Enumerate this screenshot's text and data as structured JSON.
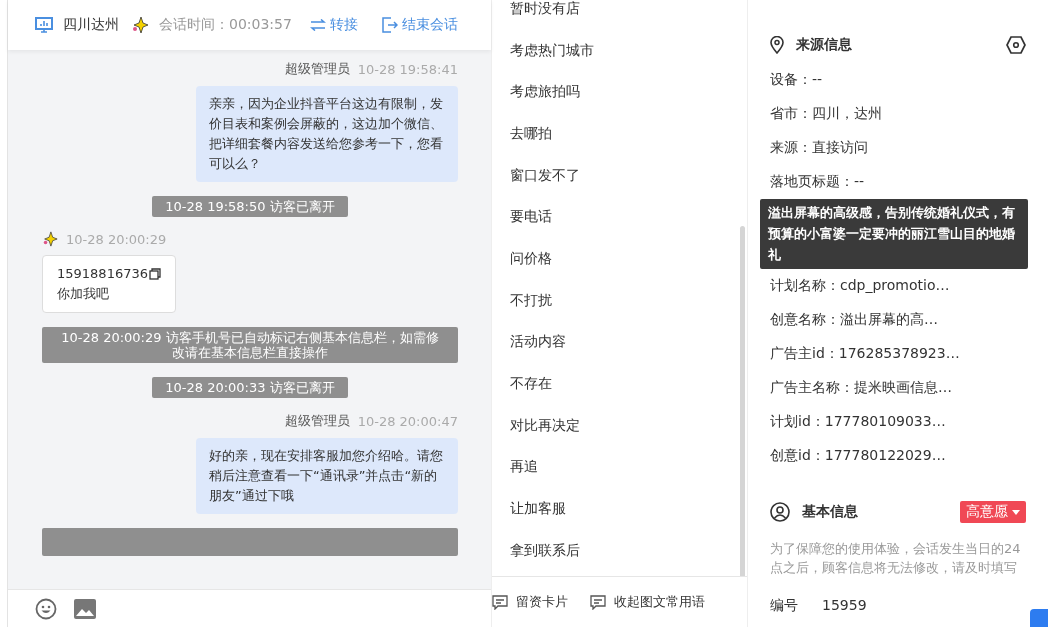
{
  "chat_header": {
    "location": "四川达州",
    "timer_label": "会话时间：00:03:57",
    "actions": [
      {
        "kind": "transfer",
        "label": "转接"
      },
      {
        "kind": "end",
        "label": "结束会话"
      }
    ]
  },
  "messages": [
    {
      "kind": "agent",
      "sender": "超级管理员",
      "time": "10-28 19:58:41",
      "text": "亲亲，因为企业抖音平台这边有限制，发价目表和案例会屏蔽的，这边加个微信、把详细套餐内容发送给您参考一下，您看可以么？"
    },
    {
      "kind": "system",
      "text": "10-28 19:58:50 访客已离开"
    },
    {
      "kind": "visitor",
      "time": "10-28 20:00:29",
      "phone": "15918816736",
      "text": "你加我吧"
    },
    {
      "kind": "system",
      "text": "10-28 20:00:29 访客手机号已自动标记右侧基本信息栏，如需修改请在基本信息栏直接操作"
    },
    {
      "kind": "system",
      "text": "10-28 20:00:33 访客已离开"
    },
    {
      "kind": "agent",
      "sender": "超级管理员",
      "time": "10-28 20:00:47",
      "text": "好的亲，现在安排客服加您介绍哈。请您稍后注意查看一下“通讯录”并点击“新的朋友”通过下哦"
    }
  ],
  "quick_replies": [
    "暂时没有店",
    "考虑热门城市",
    "考虑旅拍吗",
    "去哪拍",
    "窗口发不了",
    "要电话",
    "问价格",
    "不打扰",
    "活动内容",
    "不存在",
    "对比再决定",
    "再追",
    "让加客服",
    "拿到联系后"
  ],
  "footer_actions": [
    "留资卡片",
    "收起图文常用语"
  ],
  "source_info": {
    "title": "来源信息",
    "fields": [
      "设备：--",
      "省市：四川，达州",
      "来源：直接访问",
      "落地页标题：--",
      "计划名称：cdp_promotio…",
      "创意名称：溢出屏幕的高…",
      "广告主id：176285378923…",
      "广告主名称：提米映画信息…",
      "计划id：177780109033…",
      "创意id：177780122029…"
    ],
    "tooltip": "溢出屏幕的高级感，告别传统婚礼仪式，有预算的小富婆一定要冲的丽江雪山目的地婚礼"
  },
  "basic_info": {
    "title": "基本信息",
    "intent_tag": "高意愿",
    "note": "为了保障您的使用体验，会话发生当日的24点之后，顾客信息将无法修改，请及时填写",
    "fields": [
      {
        "label": "编号",
        "value": "15959"
      }
    ]
  }
}
